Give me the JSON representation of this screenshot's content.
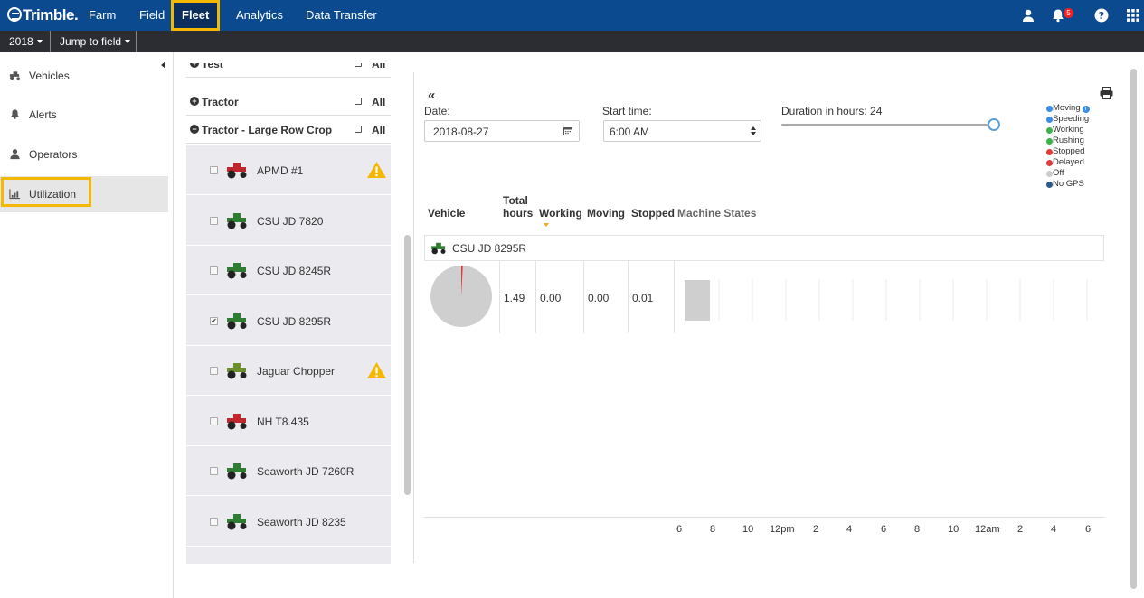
{
  "nav": {
    "logo": "Trimble.",
    "links": [
      "Farm",
      "Field",
      "Fleet",
      "Analytics",
      "Data Transfer"
    ],
    "active": "Fleet",
    "notification_count": "5"
  },
  "subbar": {
    "year": "2018",
    "jump": "Jump to field"
  },
  "sidebar": {
    "items": [
      {
        "label": "Vehicles",
        "icon": "tractor-icon"
      },
      {
        "label": "Alerts",
        "icon": "bell-icon"
      },
      {
        "label": "Operators",
        "icon": "person-icon"
      },
      {
        "label": "Utilization",
        "icon": "bar-chart-icon"
      }
    ],
    "active": "Utilization"
  },
  "vehicle_list": {
    "groups": [
      {
        "label": "Test",
        "all": "All",
        "sign": "+"
      },
      {
        "label": "Tractor",
        "all": "All",
        "sign": "+"
      },
      {
        "label": "Tractor - Large Row Crop",
        "all": "All",
        "sign": "−"
      }
    ],
    "vehicles": [
      {
        "name": "APMD #1",
        "color": "#c0262d",
        "checked": false,
        "warning": true
      },
      {
        "name": "CSU JD 7820",
        "color": "#2f7d32",
        "checked": false,
        "warning": false
      },
      {
        "name": "CSU JD 8245R",
        "color": "#2f7d32",
        "checked": false,
        "warning": false
      },
      {
        "name": "CSU JD 8295R",
        "color": "#2f7d32",
        "checked": true,
        "warning": false
      },
      {
        "name": "Jaguar Chopper",
        "color": "#6b8f2a",
        "checked": false,
        "warning": true
      },
      {
        "name": "NH T8.435",
        "color": "#c0262d",
        "checked": false,
        "warning": false
      },
      {
        "name": "Seaworth JD 7260R",
        "color": "#2f7d32",
        "checked": false,
        "warning": false
      },
      {
        "name": "Seaworth JD 8235",
        "color": "#2f7d32",
        "checked": false,
        "warning": false
      }
    ]
  },
  "filters": {
    "date_label": "Date:",
    "date_value": "2018-08-27",
    "start_label": "Start time:",
    "start_value": "6:00 AM",
    "duration_label": "Duration in hours: 24",
    "duration_fraction": 1.0
  },
  "legend": [
    {
      "label": "Moving",
      "color": "#3a8ee6",
      "info": true
    },
    {
      "label": "Speeding",
      "color": "#3a8ee6"
    },
    {
      "label": "Working",
      "color": "#3cb34a"
    },
    {
      "label": "Rushing",
      "color": "#3cb34a"
    },
    {
      "label": "Stopped",
      "color": "#e03a3a"
    },
    {
      "label": "Delayed",
      "color": "#e03a3a"
    },
    {
      "label": "Off",
      "color": "#cccccc"
    },
    {
      "label": "No GPS",
      "color": "#2e5a8a"
    }
  ],
  "table": {
    "headers": {
      "vehicle": "Vehicle",
      "total_hours_1": "Total",
      "total_hours_2": "hours",
      "working": "Working",
      "moving": "Moving",
      "stopped": "Stopped",
      "machine_states": "Machine States"
    },
    "row": {
      "vehicle": "CSU JD 8295R",
      "total_hours": "1.49",
      "working": "0.00",
      "moving": "0.00",
      "stopped": "0.01"
    }
  },
  "timeline_ticks": [
    "6",
    "8",
    "10",
    "12pm",
    "2",
    "4",
    "6",
    "8",
    "10",
    "12am",
    "2",
    "4",
    "6"
  ]
}
